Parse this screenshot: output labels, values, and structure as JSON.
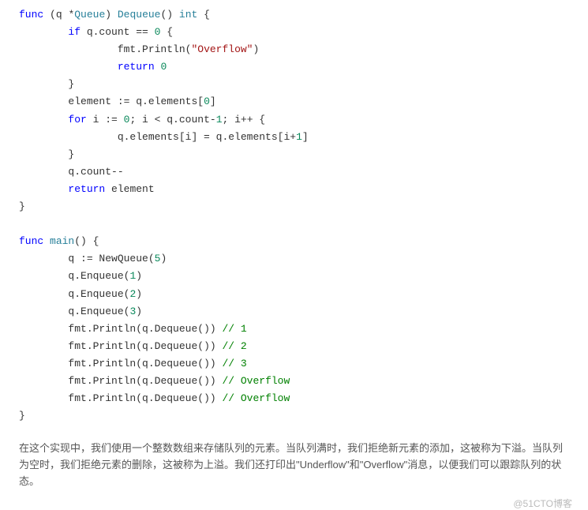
{
  "code": {
    "l1_func": "func",
    "l1_recv_open": " (q ",
    "l1_star": "*",
    "l1_type": "Queue",
    "l1_recv_close": ") ",
    "l1_method": "Dequeue",
    "l1_parens": "()",
    "l1_ret": " int",
    "l1_brace": " {",
    "l2_if": "        if",
    "l2_cond": " q.count == ",
    "l2_zero": "0",
    "l2_brace": " {",
    "l3_indent": "                ",
    "l3_fmt": "fmt.Println",
    "l3_open": "(",
    "l3_str": "\"Overflow\"",
    "l3_close": ")",
    "l4_indent": "                ",
    "l4_return": "return",
    "l4_space": " ",
    "l4_zero": "0",
    "l5": "        }",
    "l6_indent": "        ",
    "l6_var": "element := q.elements[",
    "l6_idx": "0",
    "l6_close": "]",
    "l7_indent": "        ",
    "l7_for": "for",
    "l7_init": " i := ",
    "l7_zero": "0",
    "l7_cond": "; i < q.count",
    "l7_minus": "-",
    "l7_one": "1",
    "l7_inc": "; i++ {",
    "l8_indent": "                ",
    "l8_body": "q.elements[i] = q.elements[i+",
    "l8_one": "1",
    "l8_close": "]",
    "l9": "        }",
    "l10": "        q.count--",
    "l11_indent": "        ",
    "l11_return": "return",
    "l11_var": " element",
    "l12": "}",
    "l14_func": "func",
    "l14_space": " ",
    "l14_main": "main",
    "l14_parens": "()",
    "l14_brace": " {",
    "l15_indent": "        ",
    "l15_body": "q := NewQueue(",
    "l15_num": "5",
    "l15_close": ")",
    "l16_indent": "        ",
    "l16_body": "q.Enqueue(",
    "l16_num": "1",
    "l16_close": ")",
    "l17_indent": "        ",
    "l17_body": "q.Enqueue(",
    "l17_num": "2",
    "l17_close": ")",
    "l18_indent": "        ",
    "l18_body": "q.Enqueue(",
    "l18_num": "3",
    "l18_close": ")",
    "l19_indent": "        ",
    "l19_fmt": "fmt.Println",
    "l19_open": "(q.Dequeue()) ",
    "l19_cmt": "// 1",
    "l20_indent": "        ",
    "l20_fmt": "fmt.Println",
    "l20_open": "(q.Dequeue()) ",
    "l20_cmt": "// 2",
    "l21_indent": "        ",
    "l21_fmt": "fmt.Println",
    "l21_open": "(q.Dequeue()) ",
    "l21_cmt": "// 3",
    "l22_indent": "        ",
    "l22_fmt": "fmt.Println",
    "l22_open": "(q.Dequeue()) ",
    "l22_cmt": "// Overflow",
    "l23_indent": "        ",
    "l23_fmt": "fmt.Println",
    "l23_open": "(q.Dequeue()) ",
    "l23_cmt": "// Overflow",
    "l24": "}"
  },
  "description": "在这个实现中，我们使用一个整数数组来存储队列的元素。当队列满时，我们拒绝新元素的添加，这被称为下溢。当队列为空时，我们拒绝元素的删除，这被称为上溢。我们还打印出\"Underflow\"和\"Overflow\"消息，以便我们可以跟踪队列的状态。",
  "watermark": "@51CTO博客"
}
